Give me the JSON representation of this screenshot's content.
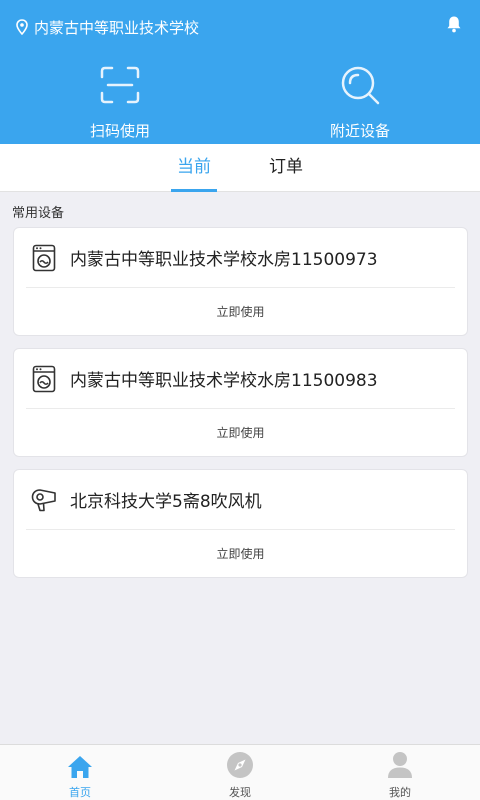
{
  "header": {
    "location": "内蒙古中等职业技术学校",
    "scan_label": "扫码使用",
    "nearby_label": "附近设备"
  },
  "tabs": [
    {
      "label": "当前"
    },
    {
      "label": "订单"
    }
  ],
  "section_title": "常用设备",
  "devices": [
    {
      "name": "内蒙古中等职业技术学校水房11500973",
      "icon": "washing-machine-icon",
      "action": "立即使用"
    },
    {
      "name": "内蒙古中等职业技术学校水房11500983",
      "icon": "washing-machine-icon",
      "action": "立即使用"
    },
    {
      "name": "北京科技大学5斋8吹风机",
      "icon": "hair-dryer-icon",
      "action": "立即使用"
    }
  ],
  "bottom_nav": [
    {
      "label": "首页",
      "icon": "home-icon"
    },
    {
      "label": "发现",
      "icon": "compass-icon"
    },
    {
      "label": "我的",
      "icon": "user-icon"
    }
  ],
  "colors": {
    "accent": "#3aa5ee",
    "background": "#efeff4"
  }
}
